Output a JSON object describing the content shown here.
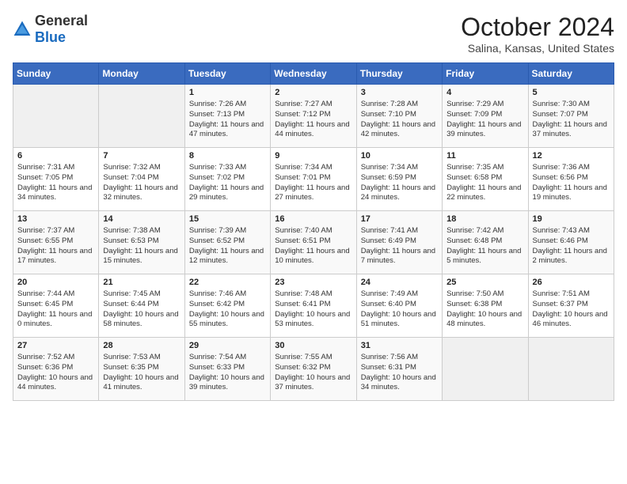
{
  "header": {
    "logo_general": "General",
    "logo_blue": "Blue",
    "month_title": "October 2024",
    "location": "Salina, Kansas, United States"
  },
  "weekdays": [
    "Sunday",
    "Monday",
    "Tuesday",
    "Wednesday",
    "Thursday",
    "Friday",
    "Saturday"
  ],
  "weeks": [
    [
      {
        "day": "",
        "empty": true
      },
      {
        "day": "",
        "empty": true
      },
      {
        "day": "1",
        "sunrise": "7:26 AM",
        "sunset": "7:13 PM",
        "daylight": "11 hours and 47 minutes."
      },
      {
        "day": "2",
        "sunrise": "7:27 AM",
        "sunset": "7:12 PM",
        "daylight": "11 hours and 44 minutes."
      },
      {
        "day": "3",
        "sunrise": "7:28 AM",
        "sunset": "7:10 PM",
        "daylight": "11 hours and 42 minutes."
      },
      {
        "day": "4",
        "sunrise": "7:29 AM",
        "sunset": "7:09 PM",
        "daylight": "11 hours and 39 minutes."
      },
      {
        "day": "5",
        "sunrise": "7:30 AM",
        "sunset": "7:07 PM",
        "daylight": "11 hours and 37 minutes."
      }
    ],
    [
      {
        "day": "6",
        "sunrise": "7:31 AM",
        "sunset": "7:05 PM",
        "daylight": "11 hours and 34 minutes."
      },
      {
        "day": "7",
        "sunrise": "7:32 AM",
        "sunset": "7:04 PM",
        "daylight": "11 hours and 32 minutes."
      },
      {
        "day": "8",
        "sunrise": "7:33 AM",
        "sunset": "7:02 PM",
        "daylight": "11 hours and 29 minutes."
      },
      {
        "day": "9",
        "sunrise": "7:34 AM",
        "sunset": "7:01 PM",
        "daylight": "11 hours and 27 minutes."
      },
      {
        "day": "10",
        "sunrise": "7:34 AM",
        "sunset": "6:59 PM",
        "daylight": "11 hours and 24 minutes."
      },
      {
        "day": "11",
        "sunrise": "7:35 AM",
        "sunset": "6:58 PM",
        "daylight": "11 hours and 22 minutes."
      },
      {
        "day": "12",
        "sunrise": "7:36 AM",
        "sunset": "6:56 PM",
        "daylight": "11 hours and 19 minutes."
      }
    ],
    [
      {
        "day": "13",
        "sunrise": "7:37 AM",
        "sunset": "6:55 PM",
        "daylight": "11 hours and 17 minutes."
      },
      {
        "day": "14",
        "sunrise": "7:38 AM",
        "sunset": "6:53 PM",
        "daylight": "11 hours and 15 minutes."
      },
      {
        "day": "15",
        "sunrise": "7:39 AM",
        "sunset": "6:52 PM",
        "daylight": "11 hours and 12 minutes."
      },
      {
        "day": "16",
        "sunrise": "7:40 AM",
        "sunset": "6:51 PM",
        "daylight": "11 hours and 10 minutes."
      },
      {
        "day": "17",
        "sunrise": "7:41 AM",
        "sunset": "6:49 PM",
        "daylight": "11 hours and 7 minutes."
      },
      {
        "day": "18",
        "sunrise": "7:42 AM",
        "sunset": "6:48 PM",
        "daylight": "11 hours and 5 minutes."
      },
      {
        "day": "19",
        "sunrise": "7:43 AM",
        "sunset": "6:46 PM",
        "daylight": "11 hours and 2 minutes."
      }
    ],
    [
      {
        "day": "20",
        "sunrise": "7:44 AM",
        "sunset": "6:45 PM",
        "daylight": "11 hours and 0 minutes."
      },
      {
        "day": "21",
        "sunrise": "7:45 AM",
        "sunset": "6:44 PM",
        "daylight": "10 hours and 58 minutes."
      },
      {
        "day": "22",
        "sunrise": "7:46 AM",
        "sunset": "6:42 PM",
        "daylight": "10 hours and 55 minutes."
      },
      {
        "day": "23",
        "sunrise": "7:48 AM",
        "sunset": "6:41 PM",
        "daylight": "10 hours and 53 minutes."
      },
      {
        "day": "24",
        "sunrise": "7:49 AM",
        "sunset": "6:40 PM",
        "daylight": "10 hours and 51 minutes."
      },
      {
        "day": "25",
        "sunrise": "7:50 AM",
        "sunset": "6:38 PM",
        "daylight": "10 hours and 48 minutes."
      },
      {
        "day": "26",
        "sunrise": "7:51 AM",
        "sunset": "6:37 PM",
        "daylight": "10 hours and 46 minutes."
      }
    ],
    [
      {
        "day": "27",
        "sunrise": "7:52 AM",
        "sunset": "6:36 PM",
        "daylight": "10 hours and 44 minutes."
      },
      {
        "day": "28",
        "sunrise": "7:53 AM",
        "sunset": "6:35 PM",
        "daylight": "10 hours and 41 minutes."
      },
      {
        "day": "29",
        "sunrise": "7:54 AM",
        "sunset": "6:33 PM",
        "daylight": "10 hours and 39 minutes."
      },
      {
        "day": "30",
        "sunrise": "7:55 AM",
        "sunset": "6:32 PM",
        "daylight": "10 hours and 37 minutes."
      },
      {
        "day": "31",
        "sunrise": "7:56 AM",
        "sunset": "6:31 PM",
        "daylight": "10 hours and 34 minutes."
      },
      {
        "day": "",
        "empty": true
      },
      {
        "day": "",
        "empty": true
      }
    ]
  ]
}
